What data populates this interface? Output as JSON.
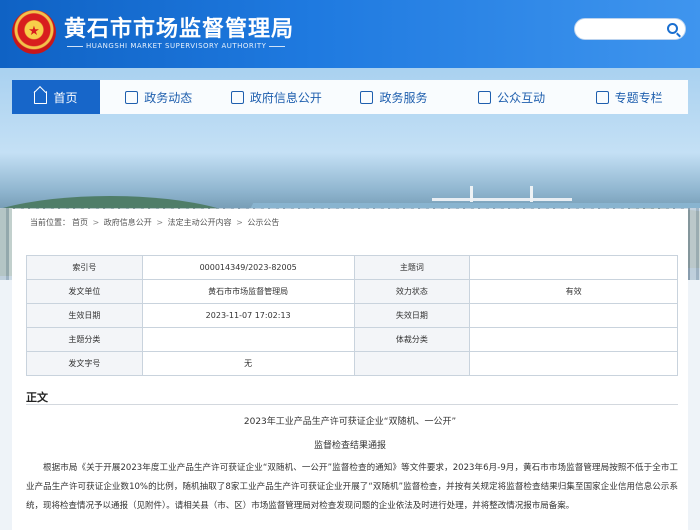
{
  "header": {
    "title": "黄石市市场监督管理局",
    "subtitle": "HUANGSHI MARKET SUPERVISORY AUTHORITY",
    "emblem_icon": "national-emblem-icon",
    "search_icon": "search-icon"
  },
  "nav": {
    "items": [
      {
        "label": "首页",
        "icon": "home-icon",
        "active": true
      },
      {
        "label": "政务动态",
        "icon": "news-icon"
      },
      {
        "label": "政府信息公开",
        "icon": "document-icon"
      },
      {
        "label": "政务服务",
        "icon": "chat-icon"
      },
      {
        "label": "公众互动",
        "icon": "bookmark-icon"
      },
      {
        "label": "专题专栏",
        "icon": "book-icon"
      }
    ]
  },
  "breadcrumb": {
    "prefix": "当前位置：",
    "items": [
      "首页",
      "政府信息公开",
      "法定主动公开内容",
      "公示公告"
    ],
    "sep": " > "
  },
  "meta_table": {
    "rows": [
      {
        "l1": "索引号",
        "v1": "000014349/2023-82005",
        "l2": "主题词",
        "v2": ""
      },
      {
        "l1": "发文单位",
        "v1": "黄石市市场监督管理局",
        "l2": "效力状态",
        "v2": "有效"
      },
      {
        "l1": "生效日期",
        "v1": "2023-11-07 17:02:13",
        "l2": "失效日期",
        "v2": ""
      },
      {
        "l1": "主题分类",
        "v1": "",
        "l2": "体裁分类",
        "v2": ""
      },
      {
        "l1": "发文字号",
        "v1": "无",
        "l2": "",
        "v2": ""
      }
    ]
  },
  "content": {
    "section_title": "正文",
    "title_line1": "2023年工业产品生产许可获证企业“双随机、一公开”",
    "title_line2": "监督检查结果通报",
    "paragraph": "根据市局《关于开展2023年度工业产品生产许可获证企业“双随机、一公开”监督检查的通知》等文件要求，2023年6月-9月，黄石市市场监督管理局按照不低于全市工业产品生产许可获证企业数10%的比例，随机抽取了8家工业产品生产许可获证企业开展了“双随机”监督检查，并按有关规定将监督检查结果归集至国家企业信用信息公示系统，现将检查情况予以通报（见附件）。请相关县（市、区）市场监督管理局对检查发现问题的企业依法及时进行处理，并将整改情况报市局备案。"
  },
  "colors": {
    "header_blue": "#1766c9",
    "nav_text": "#1f5fae",
    "table_border": "#c9d3dd"
  }
}
